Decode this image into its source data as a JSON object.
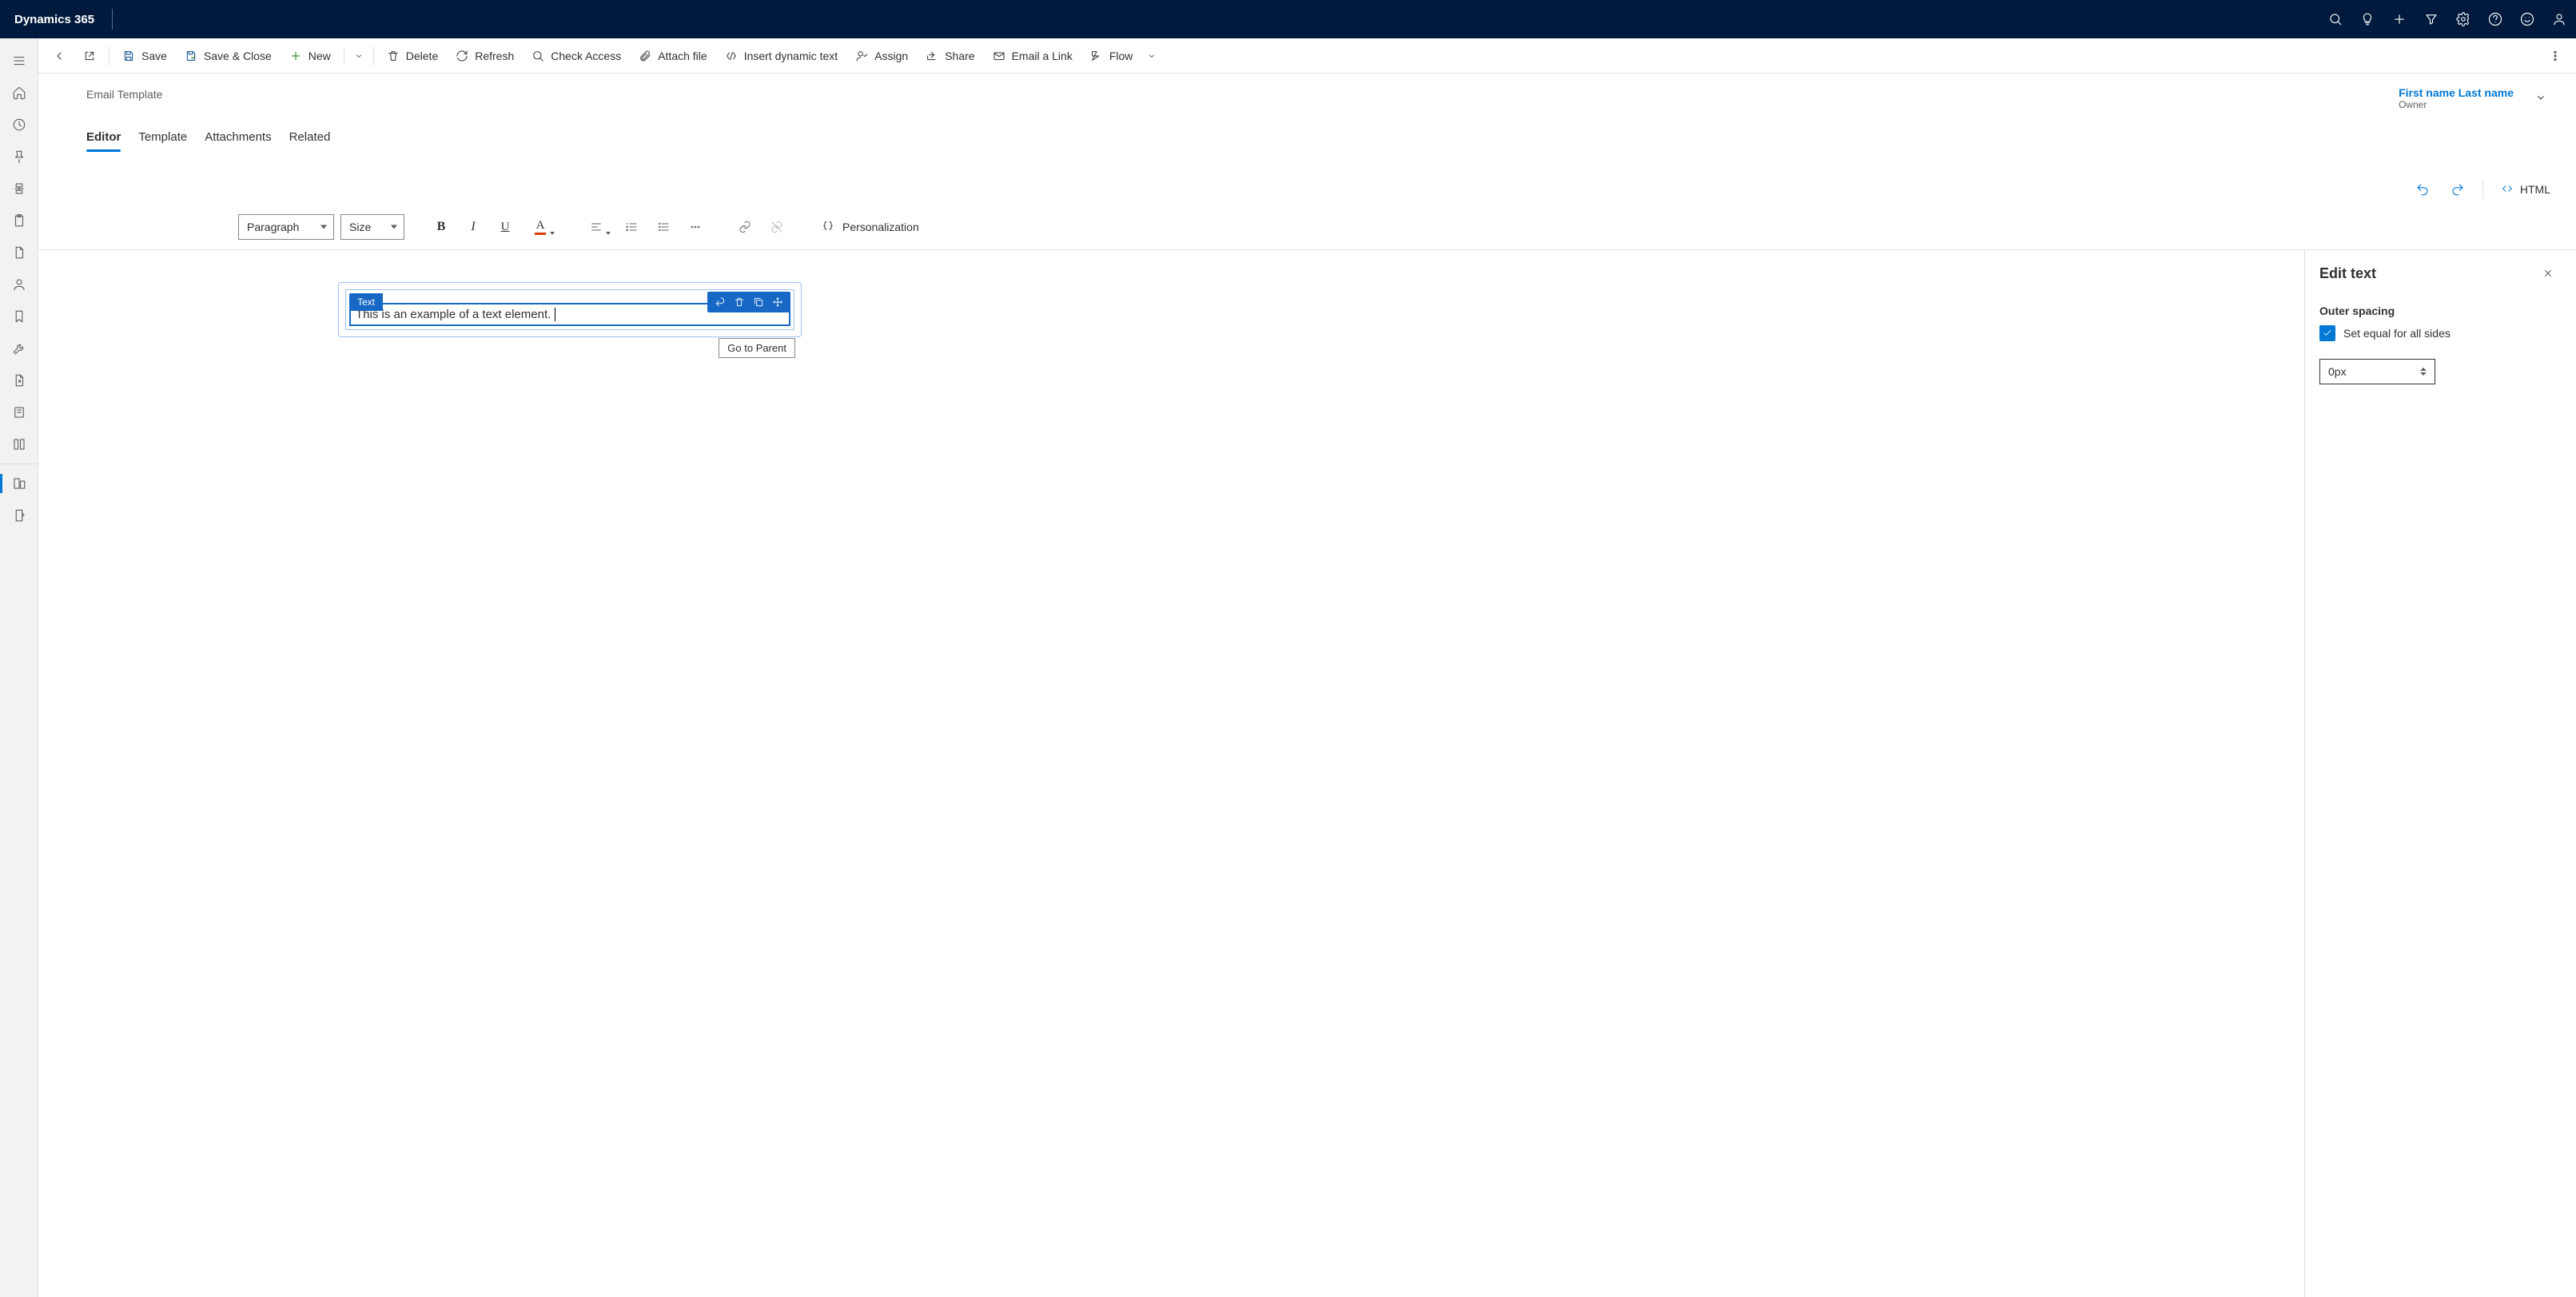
{
  "topnav": {
    "brand": "Dynamics 365"
  },
  "cmdbar": {
    "save": "Save",
    "save_close": "Save & Close",
    "new": "New",
    "delete": "Delete",
    "refresh": "Refresh",
    "check_access": "Check Access",
    "attach_file": "Attach file",
    "insert_dynamic": "Insert dynamic text",
    "assign": "Assign",
    "share": "Share",
    "email_link": "Email a Link",
    "flow": "Flow"
  },
  "header": {
    "subtitle": "Email Template",
    "owner_name": "First name Last name",
    "owner_role": "Owner"
  },
  "tabs": [
    "Editor",
    "Template",
    "Attachments",
    "Related"
  ],
  "active_tab": "Editor",
  "toolbar_right": {
    "html": "HTML"
  },
  "rtbar": {
    "paragraph": "Paragraph",
    "size": "Size",
    "personalization": "Personalization"
  },
  "canvas": {
    "element_label": "Text",
    "content": "This is an example of a text element.",
    "tooltip": "Go to Parent"
  },
  "rightpane": {
    "title": "Edit text",
    "section": "Outer spacing",
    "checkbox": "Set equal for all sides",
    "spacing_value": "0px"
  }
}
